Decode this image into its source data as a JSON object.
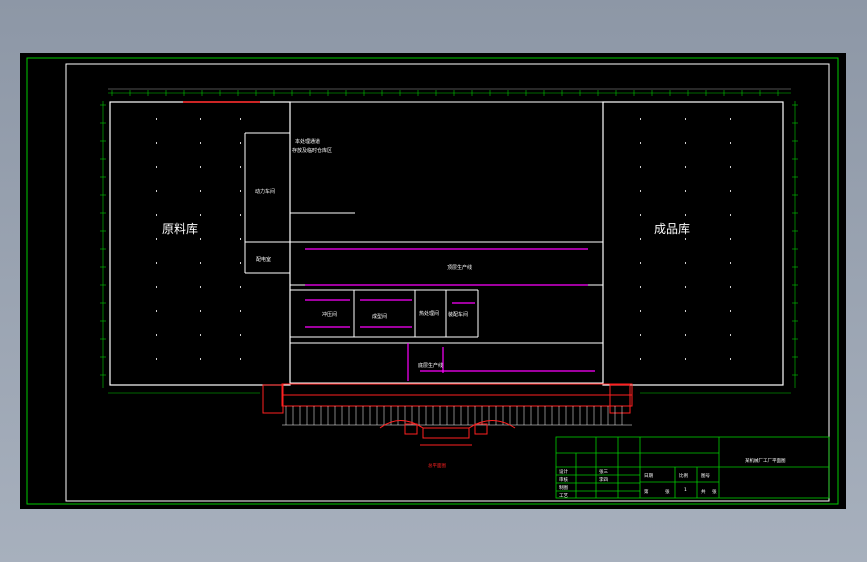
{
  "rooms": {
    "raw_warehouse": "原料库",
    "finished_warehouse": "成品库",
    "power_room": "动力车间",
    "distribution_room": "配电室",
    "main_line": "顶层生产线",
    "stamping": "冲压间",
    "molding": "成型间",
    "heat_treatment": "热处理间",
    "assembly": "装配车间",
    "lower_line": "底层生产线",
    "note_line1": "本处理通道",
    "note_line2": "存放及临时仓库区"
  },
  "gate_caption": "总平面图",
  "title_block": {
    "drawing_title": "某机械厂工厂平面图",
    "labels": [
      "设计",
      "审核",
      "制图",
      "工艺",
      "日期",
      "比例",
      "图号"
    ],
    "cells": [
      "张三",
      "李四",
      "1",
      "第",
      "张",
      "共",
      "张"
    ]
  },
  "colors": {
    "background": "#000000",
    "frame": "#00cc00",
    "walls": "#ffffff",
    "production_lines": "#ff00ff",
    "facade": "#ff2020",
    "title_block": "#00cc00"
  }
}
